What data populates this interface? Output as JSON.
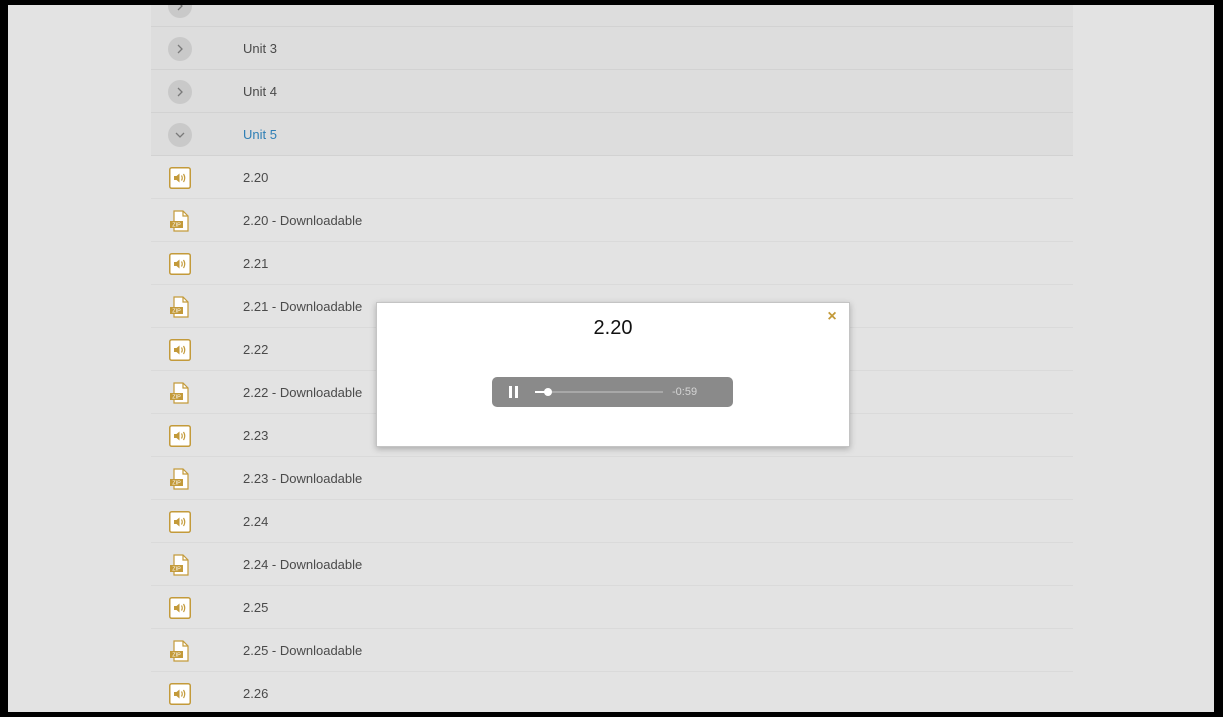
{
  "colors": {
    "page_bg": "#e3e3e3",
    "unit_bg": "#dddddd",
    "accent_gold": "#c39a3a",
    "expanded_link": "#2f7fb5",
    "player_bg": "#8a8a8a"
  },
  "units": [
    {
      "label": "Unit 3",
      "state": "collapsed",
      "icon": "chevron-right-icon"
    },
    {
      "label": "Unit 4",
      "state": "collapsed",
      "icon": "chevron-right-icon"
    },
    {
      "label": "Unit 5",
      "state": "expanded",
      "icon": "chevron-down-icon"
    }
  ],
  "items": [
    {
      "label": "2.20",
      "type": "audio",
      "icon": "audio-icon"
    },
    {
      "label": "2.20 - Downloadable",
      "type": "zip",
      "icon": "zip-file-icon"
    },
    {
      "label": "2.21",
      "type": "audio",
      "icon": "audio-icon"
    },
    {
      "label": "2.21 - Downloadable",
      "type": "zip",
      "icon": "zip-file-icon"
    },
    {
      "label": "2.22",
      "type": "audio",
      "icon": "audio-icon"
    },
    {
      "label": "2.22 - Downloadable",
      "type": "zip",
      "icon": "zip-file-icon"
    },
    {
      "label": "2.23",
      "type": "audio",
      "icon": "audio-icon"
    },
    {
      "label": "2.23 - Downloadable",
      "type": "zip",
      "icon": "zip-file-icon"
    },
    {
      "label": "2.24",
      "type": "audio",
      "icon": "audio-icon"
    },
    {
      "label": "2.24 - Downloadable",
      "type": "zip",
      "icon": "zip-file-icon"
    },
    {
      "label": "2.25",
      "type": "audio",
      "icon": "audio-icon"
    },
    {
      "label": "2.25 - Downloadable",
      "type": "zip",
      "icon": "zip-file-icon"
    },
    {
      "label": "2.26",
      "type": "audio",
      "icon": "audio-icon"
    }
  ],
  "modal": {
    "title": "2.20",
    "close_label": "×",
    "player": {
      "state": "playing",
      "control_icon": "pause-icon",
      "progress": 0.1,
      "time_remaining": "-0:59"
    }
  }
}
